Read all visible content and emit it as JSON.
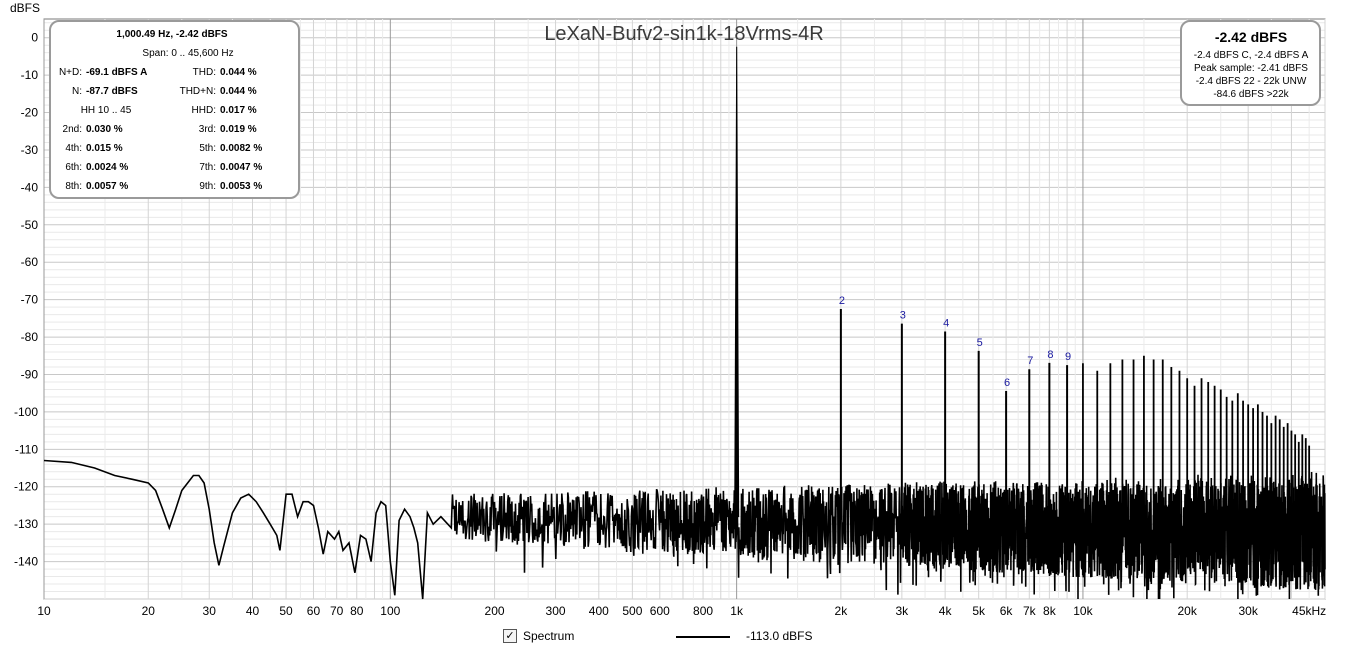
{
  "chart_data": {
    "type": "line",
    "title": "LeXaN-Bufv2-sin1k-18Vrms-4R",
    "ylabel": "dBFS",
    "xunit": "kHz",
    "xscale": "log",
    "xlim": [
      10,
      50000
    ],
    "ylim": [
      -150,
      5
    ],
    "grid": true,
    "y_ticks": [
      "0",
      "-10",
      "-20",
      "-30",
      "-40",
      "-50",
      "-60",
      "-70",
      "-80",
      "-90",
      "-100",
      "-110",
      "-120",
      "-130",
      "-140"
    ],
    "x_ticks": [
      {
        "v": 10,
        "label": "10"
      },
      {
        "v": 20,
        "label": "20"
      },
      {
        "v": 30,
        "label": "30"
      },
      {
        "v": 40,
        "label": "40"
      },
      {
        "v": 50,
        "label": "50"
      },
      {
        "v": 60,
        "label": "60"
      },
      {
        "v": 70,
        "label": "70"
      },
      {
        "v": 80,
        "label": "80"
      },
      {
        "v": 100,
        "label": "100"
      },
      {
        "v": 200,
        "label": "200"
      },
      {
        "v": 300,
        "label": "300"
      },
      {
        "v": 400,
        "label": "400"
      },
      {
        "v": 500,
        "label": "500"
      },
      {
        "v": 600,
        "label": "600"
      },
      {
        "v": 800,
        "label": "800"
      },
      {
        "v": 1000,
        "label": "1k"
      },
      {
        "v": 2000,
        "label": "2k"
      },
      {
        "v": 3000,
        "label": "3k"
      },
      {
        "v": 4000,
        "label": "4k"
      },
      {
        "v": 5000,
        "label": "5k"
      },
      {
        "v": 6000,
        "label": "6k"
      },
      {
        "v": 7000,
        "label": "7k"
      },
      {
        "v": 8000,
        "label": "8k"
      },
      {
        "v": 10000,
        "label": "10k"
      },
      {
        "v": 20000,
        "label": "20k"
      },
      {
        "v": 30000,
        "label": "30k"
      },
      {
        "v": 45000,
        "label": "45kHz"
      }
    ],
    "fundamental": {
      "freq": 1000.49,
      "level": -2.42
    },
    "harmonics": [
      {
        "n": "2",
        "freq": 2000,
        "level": -72.5
      },
      {
        "n": "3",
        "freq": 3000,
        "level": -76.4
      },
      {
        "n": "4",
        "freq": 4000,
        "level": -78.5
      },
      {
        "n": "5",
        "freq": 5000,
        "level": -83.7
      },
      {
        "n": "6",
        "freq": 6000,
        "level": -94.4
      },
      {
        "n": "7",
        "freq": 7000,
        "level": -88.6
      },
      {
        "n": "8",
        "freq": 8000,
        "level": -86.9
      },
      {
        "n": "9",
        "freq": 9000,
        "level": -87.5
      }
    ],
    "low_freq_curve": [
      [
        10,
        -113
      ],
      [
        12,
        -113.5
      ],
      [
        14,
        -115
      ],
      [
        16,
        -117
      ],
      [
        18,
        -118
      ],
      [
        20,
        -119
      ],
      [
        21,
        -121
      ],
      [
        22,
        -126
      ],
      [
        23,
        -131
      ],
      [
        24,
        -126
      ],
      [
        25,
        -121
      ],
      [
        27,
        -117
      ],
      [
        28,
        -117
      ],
      [
        29,
        -119
      ],
      [
        30,
        -126
      ],
      [
        31,
        -135
      ],
      [
        32,
        -141
      ],
      [
        33,
        -136
      ],
      [
        35,
        -127
      ],
      [
        37,
        -123
      ],
      [
        39,
        -122
      ],
      [
        41,
        -124
      ],
      [
        43,
        -127
      ],
      [
        45,
        -130
      ],
      [
        47,
        -133
      ],
      [
        48,
        -137
      ],
      [
        50,
        -122
      ],
      [
        52,
        -122
      ],
      [
        54,
        -128
      ],
      [
        56,
        -124
      ],
      [
        58,
        -124
      ],
      [
        60,
        -125
      ],
      [
        62,
        -131
      ],
      [
        64,
        -138
      ],
      [
        66,
        -132
      ],
      [
        69,
        -134
      ],
      [
        71,
        -132
      ],
      [
        73,
        -137
      ],
      [
        76,
        -135
      ],
      [
        79,
        -143
      ],
      [
        82,
        -133
      ],
      [
        85,
        -134
      ],
      [
        88,
        -140
      ],
      [
        91,
        -127
      ],
      [
        94,
        -124
      ],
      [
        97,
        -125
      ],
      [
        100,
        -140
      ],
      [
        103,
        -149
      ],
      [
        106,
        -129
      ],
      [
        110,
        -126
      ],
      [
        114,
        -128
      ],
      [
        117,
        -131
      ],
      [
        120,
        -135
      ],
      [
        124,
        -150
      ],
      [
        128,
        -127
      ],
      [
        133,
        -130
      ],
      [
        140,
        -128
      ],
      [
        150,
        -131
      ]
    ],
    "upper_harmonics": [
      [
        10000,
        -87
      ],
      [
        11000,
        -89
      ],
      [
        12000,
        -87
      ],
      [
        13000,
        -86
      ],
      [
        14000,
        -86
      ],
      [
        15000,
        -85
      ],
      [
        16000,
        -86
      ],
      [
        17000,
        -86
      ],
      [
        18000,
        -88
      ],
      [
        19000,
        -89
      ],
      [
        20000,
        -91
      ],
      [
        21000,
        -93
      ],
      [
        22000,
        -91
      ],
      [
        23000,
        -92
      ],
      [
        24000,
        -93
      ],
      [
        25000,
        -94
      ],
      [
        26000,
        -96
      ],
      [
        27000,
        -97
      ],
      [
        28000,
        -95
      ],
      [
        29000,
        -97
      ],
      [
        30000,
        -98
      ],
      [
        31000,
        -99
      ],
      [
        32000,
        -98
      ],
      [
        33000,
        -100
      ],
      [
        34000,
        -101
      ],
      [
        35000,
        -103
      ],
      [
        36000,
        -101
      ],
      [
        37000,
        -102
      ],
      [
        38000,
        -104
      ],
      [
        39000,
        -103
      ],
      [
        40000,
        -105
      ],
      [
        41000,
        -106
      ],
      [
        42000,
        -108
      ],
      [
        43000,
        -106
      ],
      [
        44000,
        -107
      ],
      [
        45000,
        -109
      ]
    ],
    "noise_floor_hf": -130
  },
  "stats_box": {
    "header": "1,000.49 Hz, -2.42 dBFS",
    "span": "Span: 0 .. 45,600 Hz",
    "rows": [
      {
        "l1": "N+D:",
        "v1": "-69.1 dBFS A",
        "l2": "THD:",
        "v2": "0.044 %"
      },
      {
        "l1": "N:",
        "v1": "-87.7 dBFS",
        "l2": "THD+N:",
        "v2": "0.044 %"
      },
      {
        "l1": "HH 10 .. 45",
        "v1": "",
        "l2": "HHD:",
        "v2": "0.017 %"
      },
      {
        "l1": "2nd:",
        "v1": "0.030 %",
        "l2": "3rd:",
        "v2": "0.019 %"
      },
      {
        "l1": "4th:",
        "v1": "0.015 %",
        "l2": "5th:",
        "v2": "0.0082 %"
      },
      {
        "l1": "6th:",
        "v1": "0.0024 %",
        "l2": "7th:",
        "v2": "0.0047 %"
      },
      {
        "l1": "8th:",
        "v1": "0.0057 %",
        "l2": "9th:",
        "v2": "0.0053 %"
      }
    ]
  },
  "level_box": {
    "main": "-2.42 dBFS",
    "lines": [
      "-2.4 dBFS C, -2.4 dBFS A",
      "Peak sample: -2.41 dBFS",
      "-2.4 dBFS 22 - 22k UNW",
      "-84.6 dBFS >22k"
    ]
  },
  "legend": {
    "checkbox_mark": "✓",
    "series_label": "Spectrum",
    "value": "-113.0 dBFS"
  }
}
